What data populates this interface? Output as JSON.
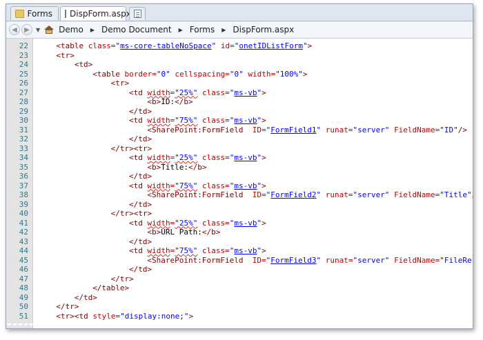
{
  "tabs": [
    {
      "label": "Forms",
      "icon": "folder-icon"
    },
    {
      "label": "DispForm.aspx",
      "icon": "document-icon"
    }
  ],
  "nav": {
    "back_icon": "back-arrow-icon",
    "forward_icon": "forward-arrow-icon",
    "breadcrumb": [
      "Demo",
      "Demo Document",
      "Forms",
      "DispForm.aspx"
    ]
  },
  "code": {
    "first_line": 22,
    "lines": [
      [
        [
          4,
          "t",
          "<table "
        ],
        [
          0,
          "a",
          "class="
        ],
        [
          0,
          "v",
          "\""
        ],
        [
          0,
          "u",
          "ms-core-tableNoSpace"
        ],
        [
          0,
          "v",
          "\" "
        ],
        [
          0,
          "a",
          "id="
        ],
        [
          0,
          "v",
          "\""
        ],
        [
          0,
          "u",
          "onetIDListForm"
        ],
        [
          0,
          "v",
          "\""
        ],
        [
          0,
          "t",
          ">"
        ]
      ],
      [
        [
          4,
          "t",
          "<tr>"
        ]
      ],
      [
        [
          8,
          "t",
          "<td>"
        ]
      ],
      [
        [
          12,
          "t",
          "<table "
        ],
        [
          0,
          "a",
          "border="
        ],
        [
          0,
          "v",
          "\"0\" "
        ],
        [
          0,
          "a",
          "cellspacing="
        ],
        [
          0,
          "v",
          "\"0\" "
        ],
        [
          0,
          "a",
          "width="
        ],
        [
          0,
          "v",
          "\"100%\""
        ],
        [
          0,
          "t",
          ">"
        ]
      ],
      [
        [
          16,
          "t",
          "<tr>"
        ]
      ],
      [
        [
          20,
          "t",
          "<td "
        ],
        [
          0,
          "as",
          "width"
        ],
        [
          0,
          "a",
          "="
        ],
        [
          0,
          "vs",
          "\"25%\""
        ],
        [
          0,
          "a",
          " class="
        ],
        [
          0,
          "v",
          "\""
        ],
        [
          0,
          "u",
          "ms-vb"
        ],
        [
          0,
          "v",
          "\""
        ],
        [
          0,
          "t",
          ">"
        ]
      ],
      [
        [
          24,
          "t",
          "<b>"
        ],
        [
          0,
          "x",
          "ID:"
        ],
        [
          0,
          "t",
          "</b>"
        ]
      ],
      [
        [
          20,
          "t",
          "</td>"
        ]
      ],
      [
        [
          20,
          "t",
          "<td "
        ],
        [
          0,
          "as",
          "width"
        ],
        [
          0,
          "a",
          "="
        ],
        [
          0,
          "vs",
          "\"75%\""
        ],
        [
          0,
          "a",
          " class="
        ],
        [
          0,
          "v",
          "\""
        ],
        [
          0,
          "u",
          "ms-vb"
        ],
        [
          0,
          "v",
          "\""
        ],
        [
          0,
          "t",
          ">"
        ]
      ],
      [
        [
          24,
          "t",
          "<SharePoint:FormField  "
        ],
        [
          0,
          "a",
          "ID="
        ],
        [
          0,
          "v",
          "\""
        ],
        [
          0,
          "u",
          "FormField1"
        ],
        [
          0,
          "v",
          "\" "
        ],
        [
          0,
          "a",
          "runat="
        ],
        [
          0,
          "v",
          "\"server\" "
        ],
        [
          0,
          "a",
          "FieldName="
        ],
        [
          0,
          "v",
          "\"ID\""
        ],
        [
          0,
          "t",
          "/>"
        ]
      ],
      [
        [
          20,
          "t",
          "</td>"
        ]
      ],
      [
        [
          16,
          "t",
          "</tr><tr>"
        ]
      ],
      [
        [
          20,
          "t",
          "<td "
        ],
        [
          0,
          "as",
          "width"
        ],
        [
          0,
          "a",
          "="
        ],
        [
          0,
          "vs",
          "\"25%\""
        ],
        [
          0,
          "a",
          " class="
        ],
        [
          0,
          "v",
          "\""
        ],
        [
          0,
          "u",
          "ms-vb"
        ],
        [
          0,
          "v",
          "\""
        ],
        [
          0,
          "t",
          ">"
        ]
      ],
      [
        [
          24,
          "t",
          "<b>"
        ],
        [
          0,
          "x",
          "Title:"
        ],
        [
          0,
          "t",
          "</b>"
        ]
      ],
      [
        [
          20,
          "t",
          "</td>"
        ]
      ],
      [
        [
          20,
          "t",
          "<td "
        ],
        [
          0,
          "as",
          "width"
        ],
        [
          0,
          "a",
          "="
        ],
        [
          0,
          "vs",
          "\"75%\""
        ],
        [
          0,
          "a",
          " class="
        ],
        [
          0,
          "v",
          "\""
        ],
        [
          0,
          "u",
          "ms-vb"
        ],
        [
          0,
          "v",
          "\""
        ],
        [
          0,
          "t",
          ">"
        ]
      ],
      [
        [
          24,
          "t",
          "<SharePoint:FormField  "
        ],
        [
          0,
          "a",
          "ID="
        ],
        [
          0,
          "v",
          "\""
        ],
        [
          0,
          "u",
          "FormField2"
        ],
        [
          0,
          "v",
          "\" "
        ],
        [
          0,
          "a",
          "runat="
        ],
        [
          0,
          "v",
          "\"server\" "
        ],
        [
          0,
          "a",
          "FieldName="
        ],
        [
          0,
          "v",
          "\"Title\""
        ],
        [
          0,
          "t",
          "/>"
        ]
      ],
      [
        [
          20,
          "t",
          "</td>"
        ]
      ],
      [
        [
          16,
          "t",
          "</tr><tr>"
        ]
      ],
      [
        [
          20,
          "t",
          "<td "
        ],
        [
          0,
          "as",
          "width"
        ],
        [
          0,
          "a",
          "="
        ],
        [
          0,
          "vs",
          "\"25%\""
        ],
        [
          0,
          "a",
          " class="
        ],
        [
          0,
          "v",
          "\""
        ],
        [
          0,
          "u",
          "ms-vb"
        ],
        [
          0,
          "v",
          "\""
        ],
        [
          0,
          "t",
          ">"
        ]
      ],
      [
        [
          24,
          "t",
          "<b>"
        ],
        [
          0,
          "x",
          "URL Path:"
        ],
        [
          0,
          "t",
          "</b>"
        ]
      ],
      [
        [
          20,
          "t",
          "</td>"
        ]
      ],
      [
        [
          20,
          "t",
          "<td "
        ],
        [
          0,
          "as",
          "width"
        ],
        [
          0,
          "a",
          "="
        ],
        [
          0,
          "vs",
          "\"75%\""
        ],
        [
          0,
          "a",
          " class="
        ],
        [
          0,
          "v",
          "\""
        ],
        [
          0,
          "u",
          "ms-vb"
        ],
        [
          0,
          "v",
          "\""
        ],
        [
          0,
          "t",
          ">"
        ]
      ],
      [
        [
          24,
          "t",
          "<SharePoint:FormField  "
        ],
        [
          0,
          "a",
          "ID="
        ],
        [
          0,
          "v",
          "\""
        ],
        [
          0,
          "u",
          "FormField3"
        ],
        [
          0,
          "v",
          "\" "
        ],
        [
          0,
          "a",
          "runat="
        ],
        [
          0,
          "v",
          "\"server\" "
        ],
        [
          0,
          "a",
          "FieldName="
        ],
        [
          0,
          "v",
          "\"FileRef\""
        ],
        [
          0,
          "t",
          "/>"
        ]
      ],
      [
        [
          20,
          "t",
          "</td>"
        ]
      ],
      [
        [
          16,
          "t",
          "</tr>"
        ]
      ],
      [
        [
          12,
          "t",
          "</table>"
        ]
      ],
      [
        [
          8,
          "t",
          "</td>"
        ]
      ],
      [
        [
          4,
          "t",
          "</tr>"
        ]
      ],
      [
        [
          4,
          "t",
          "<tr><td "
        ],
        [
          0,
          "a",
          "style="
        ],
        [
          0,
          "v",
          "\"display:none;\""
        ],
        [
          0,
          "t",
          ">"
        ]
      ]
    ]
  }
}
